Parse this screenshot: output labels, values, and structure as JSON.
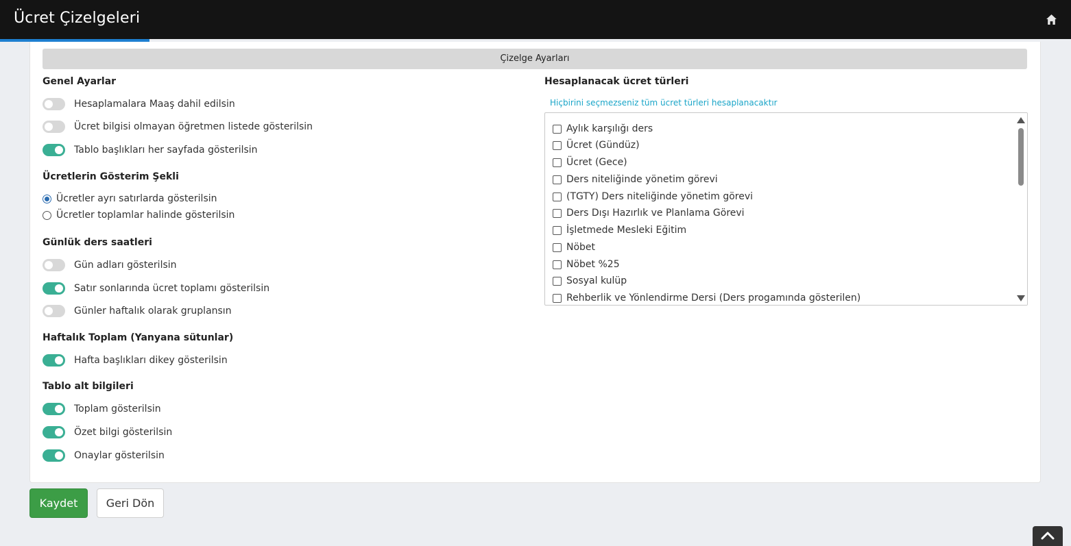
{
  "header": {
    "title": "Ücret Çizelgeleri",
    "home_icon": "home-icon"
  },
  "section_title": "Çizelge Ayarları",
  "general": {
    "heading": "Genel Ayarlar",
    "toggles": [
      {
        "label": "Hesaplamalara Maaş dahil edilsin",
        "on": false
      },
      {
        "label": "Ücret bilgisi olmayan öğretmen listede gösterilsin",
        "on": false
      },
      {
        "label": "Tablo başlıkları her sayfada gösterilsin",
        "on": true
      }
    ]
  },
  "display": {
    "heading": "Ücretlerin Gösterim Şekli",
    "options": [
      {
        "label": "Ücretler ayrı satırlarda gösterilsin",
        "checked": true
      },
      {
        "label": "Ücretler toplamlar halinde gösterilsin",
        "checked": false
      }
    ]
  },
  "daily": {
    "heading": "Günlük ders saatleri",
    "toggles": [
      {
        "label": "Gün adları gösterilsin",
        "on": false
      },
      {
        "label": "Satır sonlarında ücret toplamı gösterilsin",
        "on": true
      },
      {
        "label": "Günler haftalık olarak gruplansın",
        "on": false
      }
    ]
  },
  "weekly": {
    "heading": "Haftalık Toplam (Yanyana sütunlar)",
    "toggles": [
      {
        "label": "Hafta başlıkları dikey gösterilsin",
        "on": true
      }
    ]
  },
  "footer_info": {
    "heading": "Tablo alt bilgileri",
    "toggles": [
      {
        "label": "Toplam gösterilsin",
        "on": true
      },
      {
        "label": "Özet bilgi gösterilsin",
        "on": true
      },
      {
        "label": "Onaylar gösterilsin",
        "on": true
      }
    ]
  },
  "fee_types": {
    "heading": "Hesaplanacak ücret türleri",
    "hint": "Hiçbirini seçmezseniz tüm ücret türleri hesaplanacaktır",
    "items": [
      "Aylık karşılığı ders",
      "Ücret (Gündüz)",
      "Ücret (Gece)",
      "Ders niteliğinde yönetim görevi",
      "(TGTY) Ders niteliğinde yönetim görevi",
      "Ders Dışı Hazırlık ve Planlama Görevi",
      "İşletmede Mesleki Eğitim",
      "Nöbet",
      "Nöbet %25",
      "Sosyal kulüp",
      "Rehberlik ve Yönlendirme Dersi (Ders progamında gösterilen)"
    ]
  },
  "buttons": {
    "save": "Kaydet",
    "back": "Geri Dön"
  },
  "colors": {
    "toggle_on": "#3aaf94",
    "toggle_off": "#d8d8d8",
    "save_button": "#3c9d46",
    "hint_text": "#1aa5c8",
    "header_bg": "#141414",
    "header_accent": "#1e7fd0"
  }
}
